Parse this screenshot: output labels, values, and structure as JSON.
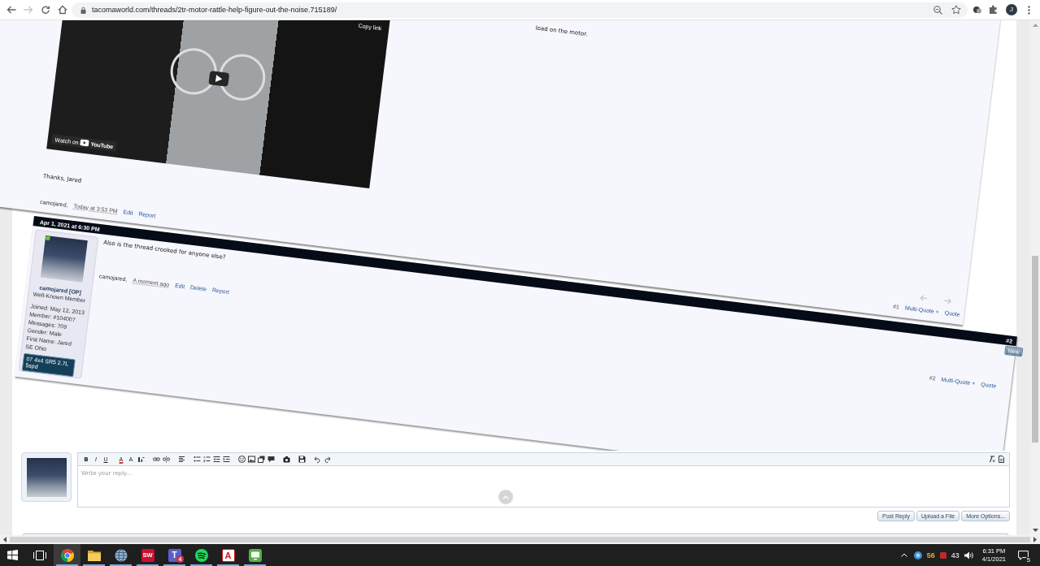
{
  "browser": {
    "forward_disabled": true,
    "url": "tacomaworld.com/threads/2tr-motor-rattle-help-figure-out-the-noise.715189/",
    "profile_initial": "J"
  },
  "thread": {
    "posts": [
      {
        "text_tail": "load on the motor.",
        "video": {
          "copy_link": "Copy link",
          "watch_on": "Watch on",
          "brand": "YouTube"
        },
        "body": "Thanks, Jared",
        "author": "camojared,",
        "time": "Today at 3:53 PM",
        "actions": [
          "Edit",
          "Report"
        ],
        "arrows": true,
        "number": "#1",
        "multi_quote": "Multi-Quote +",
        "quote": "Quote"
      },
      {
        "date": "Apr 1, 2021 at 6:30 PM",
        "bar_number": "#2",
        "badge": "New",
        "user": {
          "online": true,
          "name": "camojared [OP]",
          "title": "Well-Known Member",
          "details": [
            "Joined: May 12, 2013",
            "Member: #104007",
            "Messages: 709",
            "Gender: Male",
            "First Name: Jared",
            "SE Ohio"
          ],
          "vehicle": "07 4x4 SR5 2.7L 5spd"
        },
        "body": "Also is the thread crooked for anyone else?",
        "author": "camojared,",
        "time": "A moment ago",
        "actions": [
          "Edit",
          "Delete",
          "Report"
        ],
        "arrows": false,
        "number": "#2",
        "multi_quote": "Multi-Quote +",
        "quote": "Quote"
      }
    ]
  },
  "quick_reply": {
    "toolbar": [
      "B",
      "I",
      "U",
      "A",
      "A"
    ],
    "placeholder": "Write your reply...",
    "buttons": [
      "Post Reply",
      "Upload a File",
      "More Options..."
    ]
  },
  "taskbar": {
    "apps": [
      {
        "kind": "start",
        "running": false,
        "selected": false
      },
      {
        "kind": "task-view",
        "running": false,
        "selected": false
      },
      {
        "kind": "browser",
        "running": true,
        "selected": true
      },
      {
        "kind": "folder",
        "running": true,
        "selected": false
      },
      {
        "kind": "globe",
        "running": true,
        "selected": false
      },
      {
        "kind": "cad",
        "label": "SW",
        "running": true,
        "selected": false
      },
      {
        "kind": "chat",
        "label": "T",
        "badge": "4",
        "running": true,
        "selected": false
      },
      {
        "kind": "music",
        "running": true,
        "selected": false
      },
      {
        "kind": "pdf",
        "label": "A",
        "running": true,
        "selected": false
      },
      {
        "kind": "screen",
        "running": true,
        "selected": false
      }
    ],
    "tray": {
      "readings": [
        {
          "text": "56",
          "color": "#f0a030"
        },
        {
          "text": "43",
          "color": "#c8c8c8"
        }
      ],
      "time": "6:31 PM",
      "date": "4/1/2021",
      "notifications": "5"
    }
  }
}
